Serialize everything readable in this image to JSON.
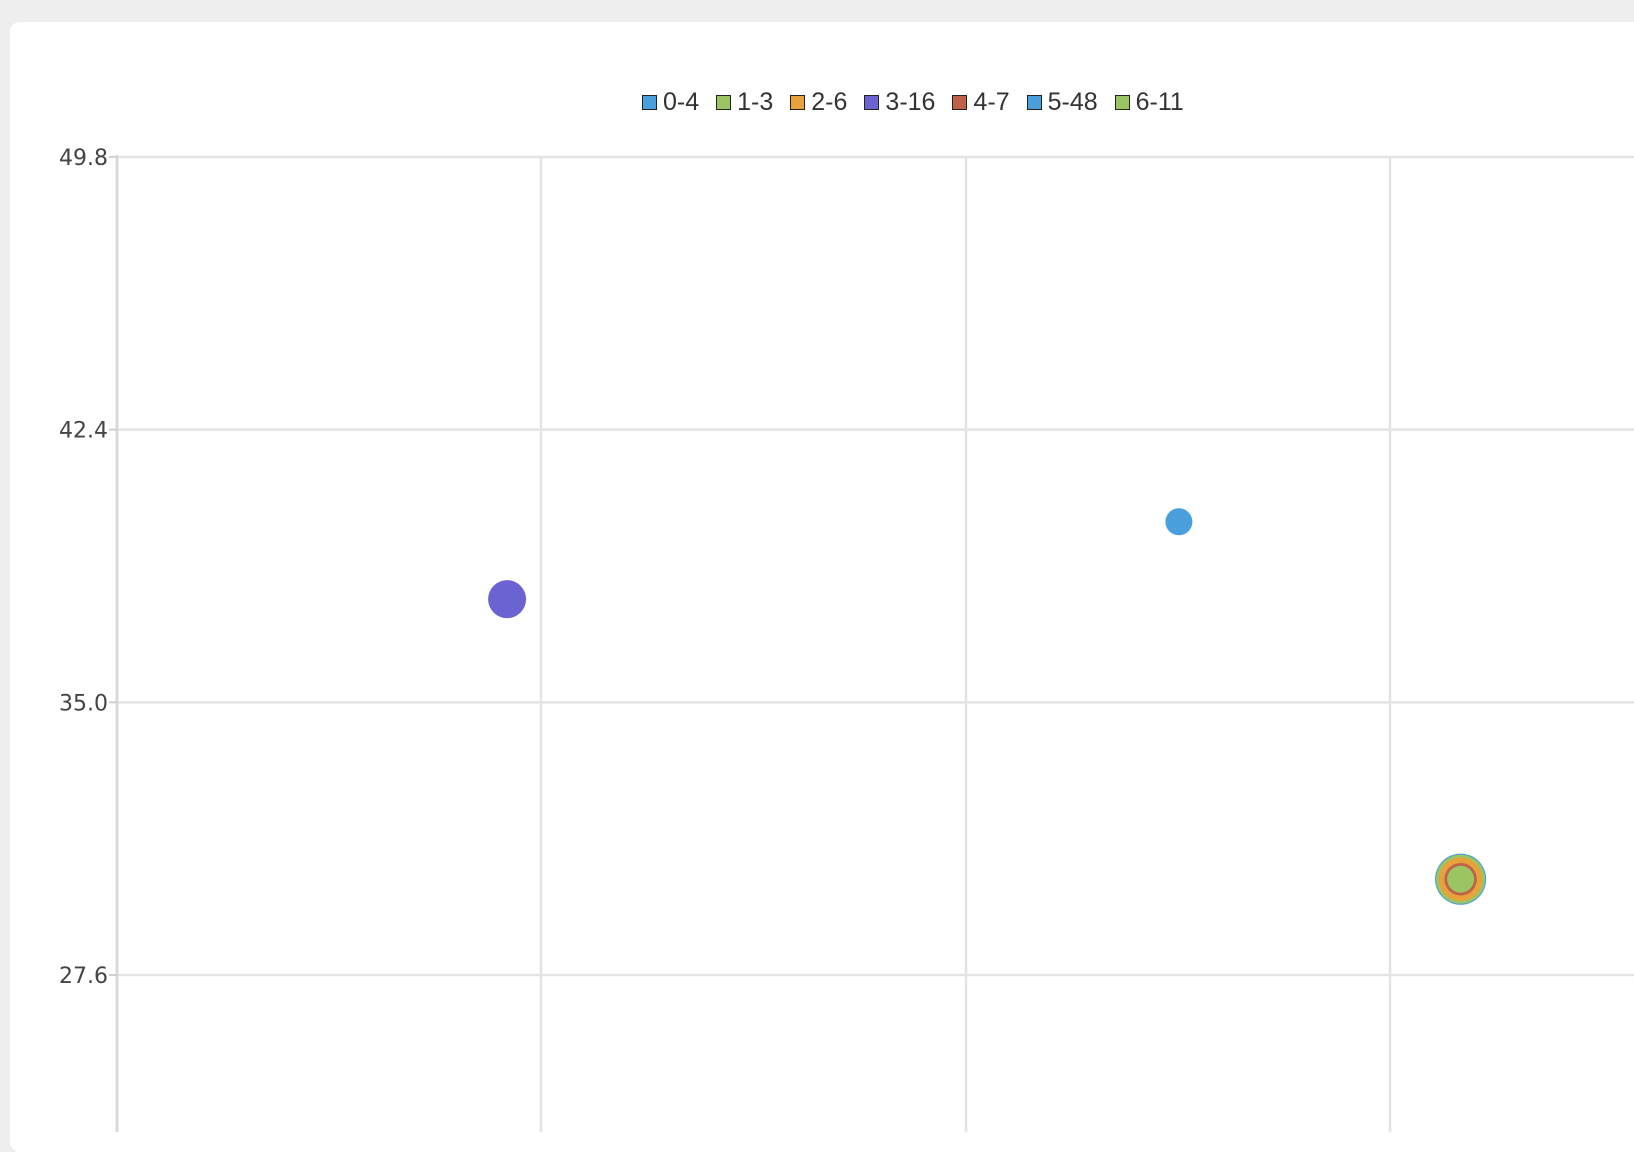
{
  "chart_data": {
    "type": "scatter",
    "title": "",
    "xlabel": "",
    "ylabel": "",
    "ylim": [
      26.5,
      49.8
    ],
    "xlim": [
      0,
      3.5
    ],
    "yticks": [
      "49.8",
      "42.4",
      "35.0",
      "27.6"
    ],
    "grid": true,
    "legend_position": "top-center",
    "series": [
      {
        "name": "0-4",
        "color": "#4aa0dc",
        "points": [
          {
            "x": 2.45,
            "y": 39.9,
            "size": 1
          }
        ]
      },
      {
        "name": "1-3",
        "color": "#9bc462",
        "points": [
          {
            "x": 3.1,
            "y": 30.2,
            "size": 3
          }
        ]
      },
      {
        "name": "2-6",
        "color": "#e8a23c",
        "points": [
          {
            "x": 3.1,
            "y": 30.2,
            "size": 2.5
          }
        ]
      },
      {
        "name": "3-16",
        "color": "#6b63d2",
        "points": [
          {
            "x": 0.9,
            "y": 37.8,
            "size": 2
          }
        ]
      },
      {
        "name": "4-7",
        "color": "#c0614a",
        "points": [
          {
            "x": 3.1,
            "y": 30.2,
            "size": 1.5
          }
        ]
      },
      {
        "name": "5-48",
        "color": "#4aa0dc",
        "points": [
          {
            "x": 3.1,
            "y": 30.2,
            "size": 3.2
          }
        ]
      },
      {
        "name": "6-11",
        "color": "#9bc462",
        "points": [
          {
            "x": 3.1,
            "y": 30.2,
            "size": 1
          }
        ]
      }
    ]
  }
}
